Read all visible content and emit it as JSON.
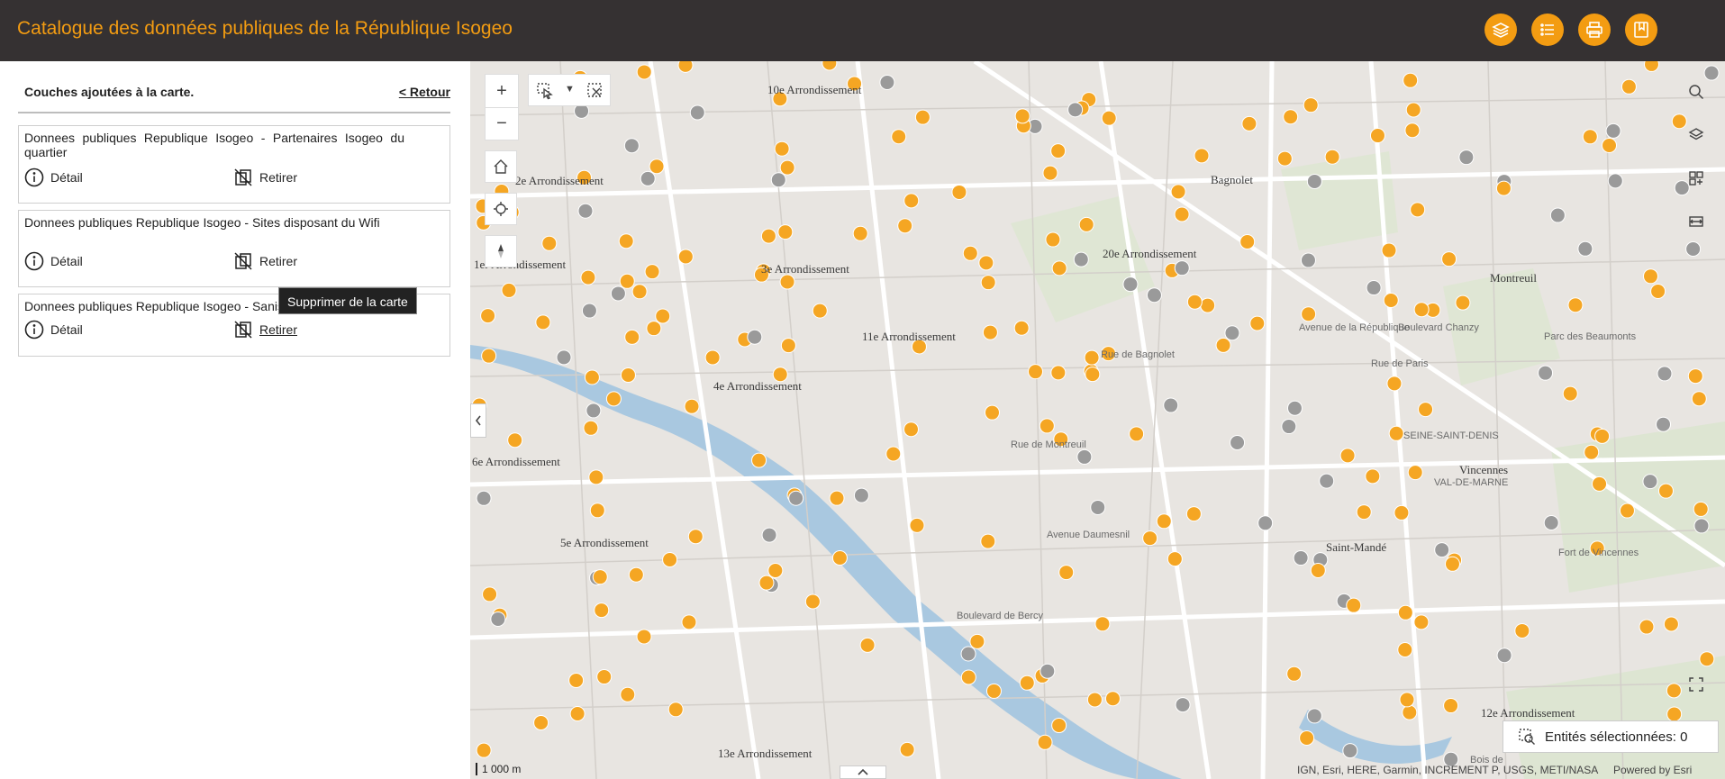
{
  "header": {
    "title": "Catalogue des données publiques de la République Isogeo",
    "buttons": [
      {
        "name": "layers-button",
        "icon": "layers-icon"
      },
      {
        "name": "list-button",
        "icon": "list-icon"
      },
      {
        "name": "print-button",
        "icon": "print-icon"
      },
      {
        "name": "bookmark-button",
        "icon": "bookmark-icon"
      }
    ],
    "accent_color": "#f39c12",
    "bar_color": "#353132"
  },
  "panel": {
    "title": "Couches ajoutées à la carte.",
    "back_label": "< Retour",
    "layers": [
      {
        "name": "Donnees publiques Republique Isogeo - Partenaires Isogeo du quartier",
        "detail_label": "Détail",
        "remove_label": "Retirer"
      },
      {
        "name": "Donnees publiques Republique Isogeo - Sites disposant du Wifi",
        "detail_label": "Détail",
        "remove_label": "Retirer"
      },
      {
        "name": "Donnees publiques Republique Isogeo - Sanisettes",
        "detail_label": "Détail",
        "remove_label": "Retirer"
      }
    ],
    "tooltip": "Supprimer de la carte"
  },
  "map": {
    "labels": [
      "10e Arrondissement",
      "2e Arrondissement",
      "3e Arrondissement",
      "1er Arrondissement",
      "11e Arrondissement",
      "20e Arrondissement",
      "4e Arrondissement",
      "6e Arrondissement",
      "5e Arrondissement",
      "13e Arrondissement",
      "12e Arrondissement",
      "Bagnolet",
      "Montreuil",
      "Vincennes",
      "Saint-Mandé",
      "Parc des Beaumonts",
      "Fort de Vincennes",
      "SEINE-SAINT-DENIS",
      "VAL-DE-MARNE",
      "Boulevard de Bercy",
      "Rue de Montreuil",
      "Avenue Daumesnil",
      "Rue de Bagnolet",
      "Avenue de la République",
      "Rue de Paris",
      "Boulevard Chanzy",
      "Bois de"
    ],
    "selection_label": "Entités sélectionnées: 0",
    "scale_label": "1 000 m",
    "attribution": "IGN, Esri, HERE, Garmin, INCREMENT P, USGS, METI/NASA",
    "powered_by": "Powered by Esri"
  }
}
